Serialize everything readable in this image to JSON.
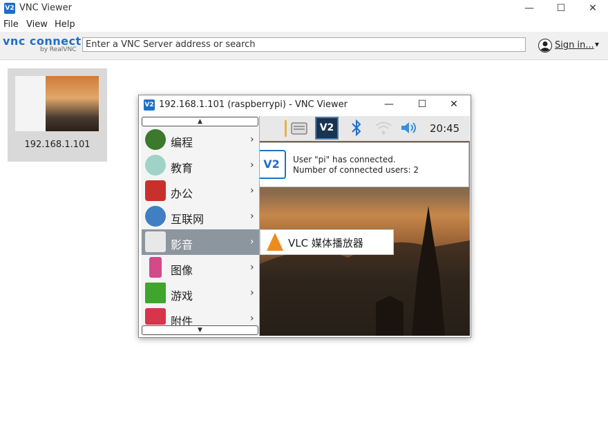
{
  "window": {
    "title": "VNC Viewer",
    "minimize": "—",
    "maximize": "☐",
    "close": "✕"
  },
  "menu": [
    "File",
    "View",
    "Help"
  ],
  "toolbar": {
    "logo_main": "vnc connect",
    "logo_sub": "by RealVNC",
    "address_placeholder": "Enter a VNC Server address or search",
    "signin": "Sign in...",
    "signin_arrow": "▾"
  },
  "thumbnail": {
    "label": "192.168.1.101"
  },
  "vnc_window": {
    "title": "192.168.1.101 (raspberrypi) - VNC Viewer",
    "icon_text": "V2",
    "minimize": "—",
    "maximize": "☐",
    "close": "✕",
    "clock": "20:45",
    "notification": {
      "line1": "User \"pi\" has connected.",
      "line2": "Number of connected users: 2",
      "logo": "V2"
    },
    "start_menu": {
      "scroll_up": "▲",
      "scroll_down": "▼",
      "items": [
        {
          "label": "编程",
          "arrow": "›",
          "icon": "programming-icon"
        },
        {
          "label": "教育",
          "arrow": "›",
          "icon": "education-icon"
        },
        {
          "label": "办公",
          "arrow": "›",
          "icon": "office-icon"
        },
        {
          "label": "互联网",
          "arrow": "›",
          "icon": "internet-icon"
        },
        {
          "label": "影音",
          "arrow": "›",
          "icon": "media-icon"
        },
        {
          "label": "图像",
          "arrow": "›",
          "icon": "graphics-icon"
        },
        {
          "label": "游戏",
          "arrow": "›",
          "icon": "games-icon"
        },
        {
          "label": "附件",
          "arrow": "›",
          "icon": "accessories-icon"
        }
      ]
    },
    "submenu": {
      "label": "VLC 媒体播放器",
      "icon": "vlc-icon"
    }
  },
  "colors": {
    "accent": "#1e6fc9",
    "active_item": "#8c969e"
  }
}
